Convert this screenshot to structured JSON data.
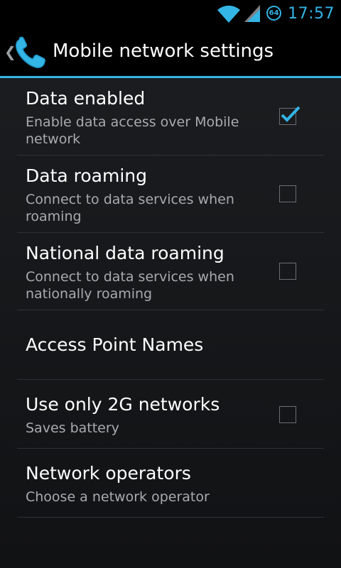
{
  "status_bar": {
    "time": "17:57",
    "badge": "64",
    "icons": [
      "wifi-icon",
      "signal-icon"
    ],
    "accent": "#33b5e5"
  },
  "action_bar": {
    "title": "Mobile network settings",
    "up_glyph": "❮",
    "app_icon": "phone-icon"
  },
  "settings": [
    {
      "title": "Data enabled",
      "summary": "Enable data access over Mobile network",
      "checked": true
    },
    {
      "title": "Data roaming",
      "summary": "Connect to data services when roaming",
      "checked": false
    },
    {
      "title": "National data roaming",
      "summary": "Connect to data services when nationally roaming",
      "checked": false
    },
    {
      "title": "Access Point Names"
    },
    {
      "title": "Use only 2G networks",
      "summary": "Saves battery",
      "checked": false
    },
    {
      "title": "Network operators",
      "summary": "Choose a network operator"
    }
  ]
}
